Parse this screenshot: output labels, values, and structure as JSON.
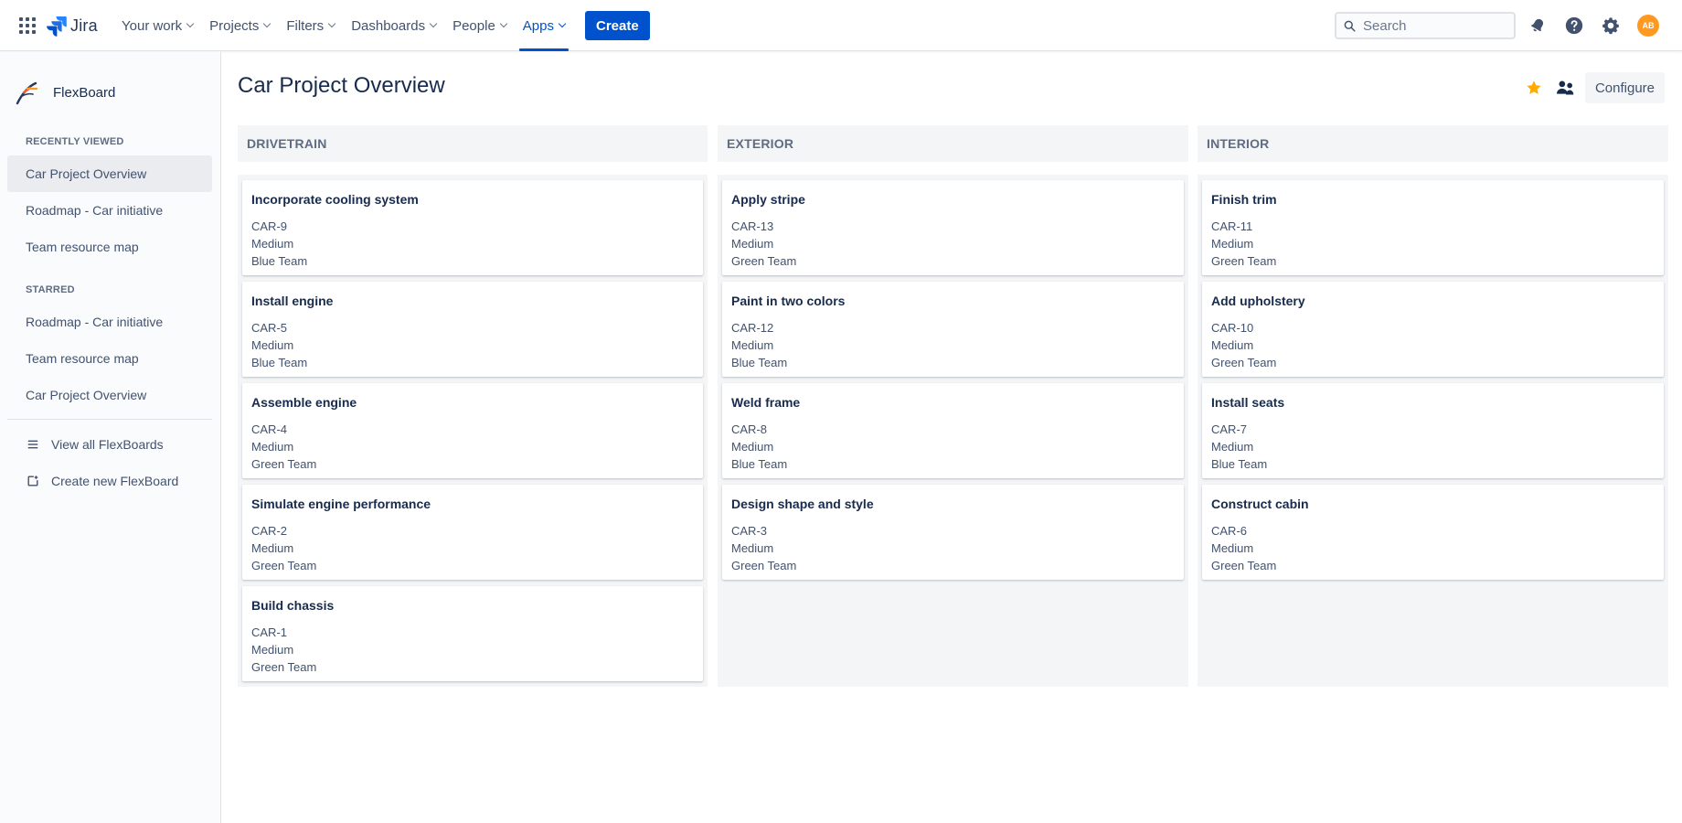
{
  "topnav": {
    "logo_text": "Jira",
    "items": [
      {
        "label": "Your work"
      },
      {
        "label": "Projects"
      },
      {
        "label": "Filters"
      },
      {
        "label": "Dashboards"
      },
      {
        "label": "People"
      },
      {
        "label": "Apps",
        "active": true
      }
    ],
    "create_label": "Create",
    "search_placeholder": "Search",
    "avatar_initials": "AB",
    "colors": {
      "accent": "#0052cc",
      "avatar": "#ff991f"
    }
  },
  "sidebar": {
    "title": "FlexBoard",
    "recently_viewed_heading": "RECENTLY VIEWED",
    "recently_viewed": [
      {
        "label": "Car Project Overview",
        "selected": true
      },
      {
        "label": "Roadmap - Car initiative"
      },
      {
        "label": "Team resource map"
      }
    ],
    "starred_heading": "STARRED",
    "starred": [
      {
        "label": "Roadmap - Car initiative"
      },
      {
        "label": "Team resource map"
      },
      {
        "label": "Car Project Overview"
      }
    ],
    "view_all_label": "View all FlexBoards",
    "create_new_label": "Create new FlexBoard"
  },
  "main": {
    "title": "Car Project Overview",
    "configure_label": "Configure",
    "star_color": "#ffab00",
    "columns": [
      {
        "name": "DRIVETRAIN",
        "cards": [
          {
            "title": "Incorporate cooling system",
            "key": "CAR-9",
            "priority": "Medium",
            "team": "Blue Team"
          },
          {
            "title": "Install engine",
            "key": "CAR-5",
            "priority": "Medium",
            "team": "Blue Team"
          },
          {
            "title": "Assemble engine",
            "key": "CAR-4",
            "priority": "Medium",
            "team": "Green Team"
          },
          {
            "title": "Simulate engine performance",
            "key": "CAR-2",
            "priority": "Medium",
            "team": "Green Team"
          },
          {
            "title": "Build chassis",
            "key": "CAR-1",
            "priority": "Medium",
            "team": "Green Team"
          }
        ]
      },
      {
        "name": "EXTERIOR",
        "cards": [
          {
            "title": "Apply stripe",
            "key": "CAR-13",
            "priority": "Medium",
            "team": "Green Team"
          },
          {
            "title": "Paint in two colors",
            "key": "CAR-12",
            "priority": "Medium",
            "team": "Blue Team"
          },
          {
            "title": "Weld frame",
            "key": "CAR-8",
            "priority": "Medium",
            "team": "Blue Team"
          },
          {
            "title": "Design shape and style",
            "key": "CAR-3",
            "priority": "Medium",
            "team": "Green Team"
          }
        ]
      },
      {
        "name": "INTERIOR",
        "cards": [
          {
            "title": "Finish trim",
            "key": "CAR-11",
            "priority": "Medium",
            "team": "Green Team"
          },
          {
            "title": "Add upholstery",
            "key": "CAR-10",
            "priority": "Medium",
            "team": "Green Team"
          },
          {
            "title": "Install seats",
            "key": "CAR-7",
            "priority": "Medium",
            "team": "Blue Team"
          },
          {
            "title": "Construct cabin",
            "key": "CAR-6",
            "priority": "Medium",
            "team": "Green Team"
          }
        ]
      }
    ]
  }
}
